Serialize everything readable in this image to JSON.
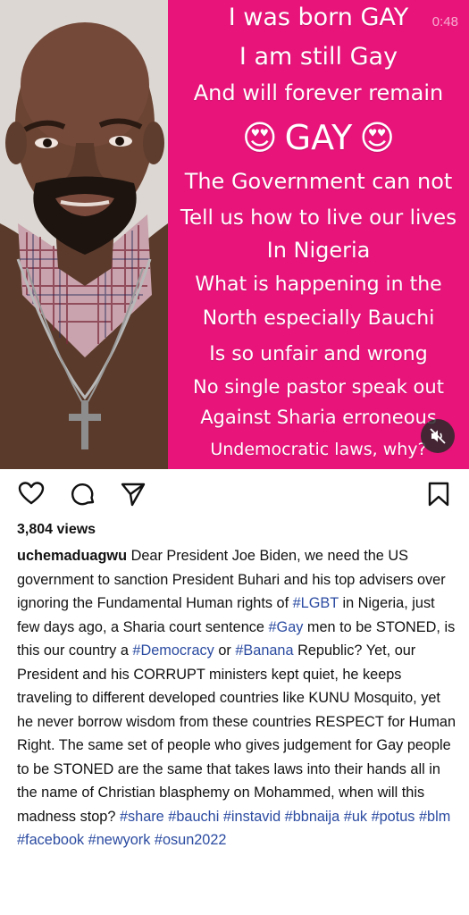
{
  "media": {
    "timer": "0:48",
    "lines": {
      "l1": "I was born GAY",
      "l2": "I am still Gay",
      "l3": "And will forever remain",
      "l4": "GAY",
      "l5": "The Government can not",
      "l6": "Tell us how to live our lives",
      "l7": "In Nigeria",
      "l8": "What is happening in the",
      "l9": "North especially Bauchi",
      "l10": "Is so unfair and wrong",
      "l11": "No single pastor speak out",
      "l12": "Against Sharia erroneous",
      "l13": "Undemocratic laws, why?"
    },
    "emoji": "😍",
    "background_color": "#e8147a"
  },
  "post": {
    "views": "3,804 views",
    "username": "uchemaduagwu",
    "caption": [
      {
        "t": " Dear President Joe Biden, we need the US government to sanction President Buhari and his top advisers over ignoring the Fundamental Human rights of "
      },
      {
        "tag": "#LGBT"
      },
      {
        "t": " in Nigeria, just few days ago, a Sharia court sentence "
      },
      {
        "tag": "#Gay"
      },
      {
        "t": " men to be STONED, is this our country a "
      },
      {
        "tag": "#Democracy"
      },
      {
        "t": " or "
      },
      {
        "tag": "#Banana"
      },
      {
        "t": " Republic? Yet, our President and his CORRUPT ministers kept quiet, he keeps traveling to different developed countries like KUNU Mosquito, yet he never borrow wisdom from these countries RESPECT for Human Right. The same set of people who gives judgement for Gay people to be STONED are the same that takes laws into their hands all in the name of Christian blasphemy on Mohammed, when will this madness stop? "
      },
      {
        "tag": "#share"
      },
      {
        "t": " "
      },
      {
        "tag": "#bauchi"
      },
      {
        "t": " "
      },
      {
        "tag": "#instavid"
      },
      {
        "t": " "
      },
      {
        "tag": "#bbnaija"
      },
      {
        "t": " "
      },
      {
        "tag": "#uk"
      },
      {
        "t": " "
      },
      {
        "tag": "#potus"
      },
      {
        "t": " "
      },
      {
        "tag": "#blm"
      },
      {
        "t": " "
      },
      {
        "tag": "#facebook"
      },
      {
        "t": " "
      },
      {
        "tag": "#newyork"
      },
      {
        "t": " "
      },
      {
        "tag": "#osun2022"
      }
    ],
    "hashtag_color": "#2b4ba1"
  },
  "icons": {
    "like": "heart-icon",
    "comment": "comment-icon",
    "share": "send-icon",
    "save": "bookmark-icon",
    "mute": "speaker-muted-icon"
  }
}
